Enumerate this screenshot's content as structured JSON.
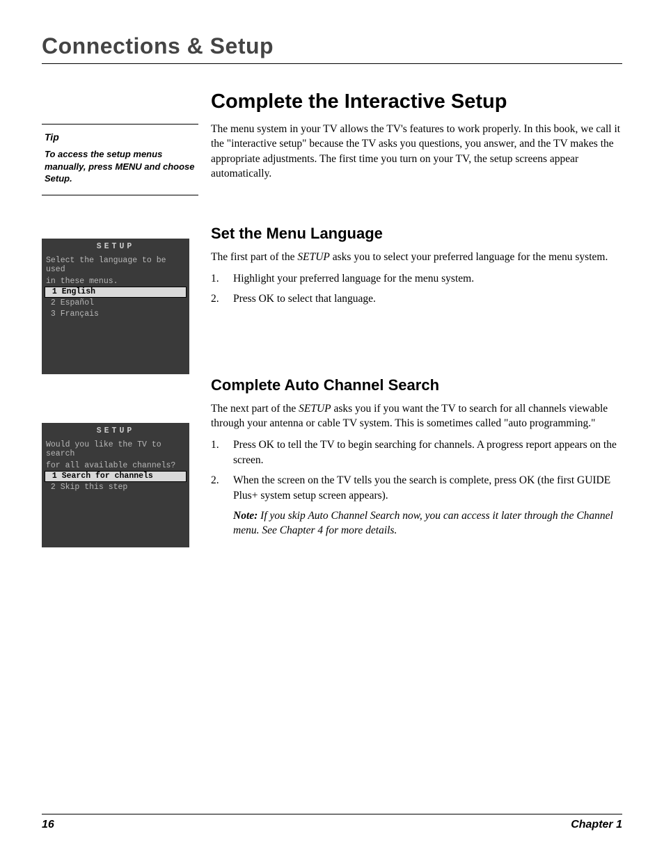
{
  "header": {
    "chapter_title": "Connections & Setup"
  },
  "tip": {
    "title": "Tip",
    "body": "To access the setup menus manually, press MENU and choose Setup."
  },
  "section_main": {
    "heading": "Complete the Interactive Setup",
    "intro": "The menu system in your TV allows the TV's features to work properly. In this book, we call it the \"interactive setup\" because the TV asks you questions, you answer, and the TV makes the appropriate adjustments. The first time you turn on your TV, the setup screens appear automatically."
  },
  "section_lang": {
    "heading": "Set the Menu Language",
    "intro_pre": "The first part of the ",
    "intro_em": "SETUP",
    "intro_post": " asks you to select your preferred language for the menu system.",
    "step1_num": "1.",
    "step1": "Highlight your preferred language for the menu system.",
    "step2_num": "2.",
    "step2": "Press OK to select that language."
  },
  "section_search": {
    "heading": "Complete Auto Channel Search",
    "intro_pre": "The next part of the ",
    "intro_em": "SETUP",
    "intro_post": " asks you if you want the TV to search for all channels viewable through your antenna or cable TV system. This is sometimes called \"auto programming.\"",
    "step1_num": "1.",
    "step1": "Press OK to tell the TV to begin searching for channels. A progress report appears on the screen.",
    "step2_num": "2.",
    "step2": "When the screen on the TV tells you the search is complete, press OK (the first GUIDE Plus+ system setup screen appears).",
    "note_label": "Note:",
    "note_body": "  If you skip Auto Channel Search now, you can access it later through the Channel menu. See Chapter 4 for more details."
  },
  "screen_lang": {
    "title": "SETUP",
    "prompt_l1": "Select the language to be used",
    "prompt_l2": "in these menus.",
    "opt1": " 1 English",
    "opt2": " 2 Español",
    "opt3": " 3 Français"
  },
  "screen_search": {
    "title": "SETUP",
    "prompt_l1": "Would you like the TV to search",
    "prompt_l2": "for all available channels?",
    "opt1": " 1 Search for channels",
    "opt2": " 2 Skip this step"
  },
  "footer": {
    "page": "16",
    "chapter": "Chapter 1"
  }
}
